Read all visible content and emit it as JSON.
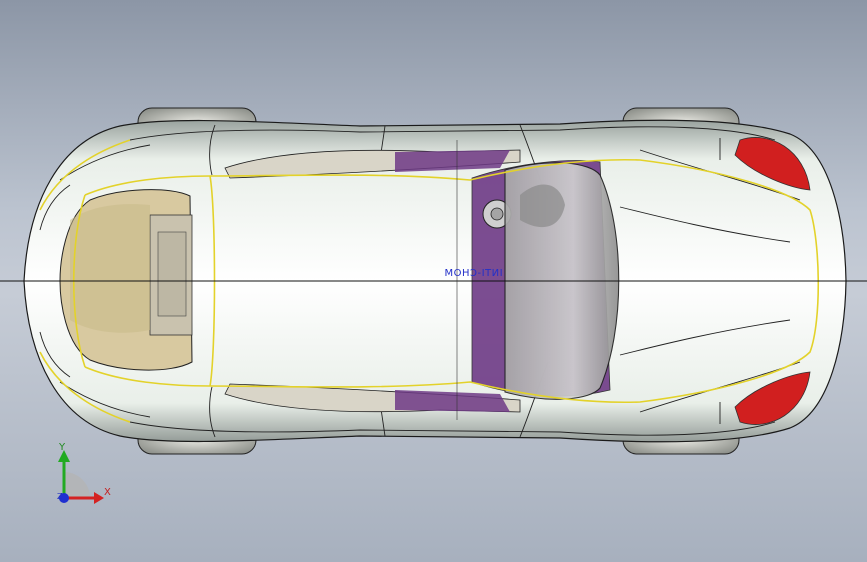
{
  "viewport": {
    "view": "top",
    "background_top": "#8c96a6",
    "background_bottom": "#a7b0be"
  },
  "model": {
    "body_color": "#f4f4f4",
    "edge_color": "#1a1a1a",
    "split_line_color": "#e3d22a",
    "interior_color": "#6e3a86",
    "seat_color": "#d9c9a3",
    "taillight_color": "#d11f1f",
    "embossed_text": "INTI-CHOM"
  },
  "triad": {
    "x_label": "X",
    "y_label": "Y",
    "z_label": "Z",
    "x_color": "#d42222",
    "y_color": "#22aa22",
    "z_color": "#1f2fd0"
  }
}
